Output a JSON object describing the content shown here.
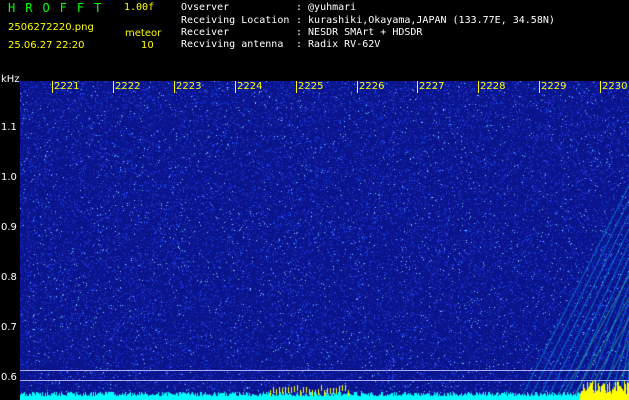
{
  "header": {
    "app_title": "HROFFT",
    "version": "1.00f",
    "filename": "2506272220.png",
    "meteor_label": "meteor",
    "datetime": "25.06.27 22:20",
    "meteor_count": "10"
  },
  "info": [
    {
      "label": "Ovserver",
      "value": ": @yuhmari"
    },
    {
      "label": "Receiving Location",
      "value": ": kurashiki,Okayama,JAPAN (133.77E, 34.58N)"
    },
    {
      "label": "Receiver",
      "value": ": NESDR SMArt + HDSDR"
    },
    {
      "label": "Recviving antenna",
      "value": ": Radix RV-62V"
    }
  ],
  "axis": {
    "unit": "kHz",
    "freq_ticks": [
      {
        "label": "1.1",
        "value": 1.1
      },
      {
        "label": "1.0",
        "value": 1.0
      },
      {
        "label": "0.9",
        "value": 0.9
      },
      {
        "label": "0.8",
        "value": 0.8
      },
      {
        "label": "0.7",
        "value": 0.7
      },
      {
        "label": "0.6",
        "value": 0.6
      }
    ],
    "time_ticks": [
      "2221",
      "2222",
      "2223",
      "2224",
      "2225",
      "2226",
      "2227",
      "2228",
      "2229",
      "2230"
    ]
  },
  "colors": {
    "background": "#0a148c",
    "noise_mid": "#2850ff",
    "noise_hi": "#80d0ff",
    "signal": "#00ffff",
    "meteor": "#ffff00"
  }
}
